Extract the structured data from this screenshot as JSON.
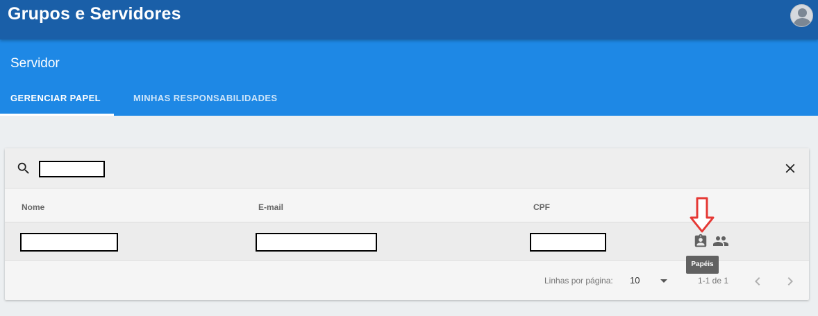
{
  "app": {
    "title": "Grupos e Servidores"
  },
  "header": {
    "section_title": "Servidor"
  },
  "tabs": [
    {
      "label": "GERENCIAR PAPEL",
      "active": true
    },
    {
      "label": "MINHAS RESPONSABILIDADES",
      "active": false
    }
  ],
  "search": {
    "value": "",
    "placeholder": ""
  },
  "table": {
    "columns": [
      "Nome",
      "E-mail",
      "CPF"
    ],
    "rows": [
      {
        "nome": "",
        "email": "",
        "cpf": ""
      }
    ],
    "actions": {
      "roles_icon": "assignment-ind-icon",
      "group_icon": "people-icon",
      "tooltip": "Papéis"
    }
  },
  "pagination": {
    "rows_per_page_label": "Linhas por página:",
    "rows_per_page_value": "10",
    "range": "1-1 de 1"
  },
  "colors": {
    "topbar": "#1a5fa8",
    "subheader": "#1e88e5",
    "annotation_arrow": "#e53935"
  }
}
